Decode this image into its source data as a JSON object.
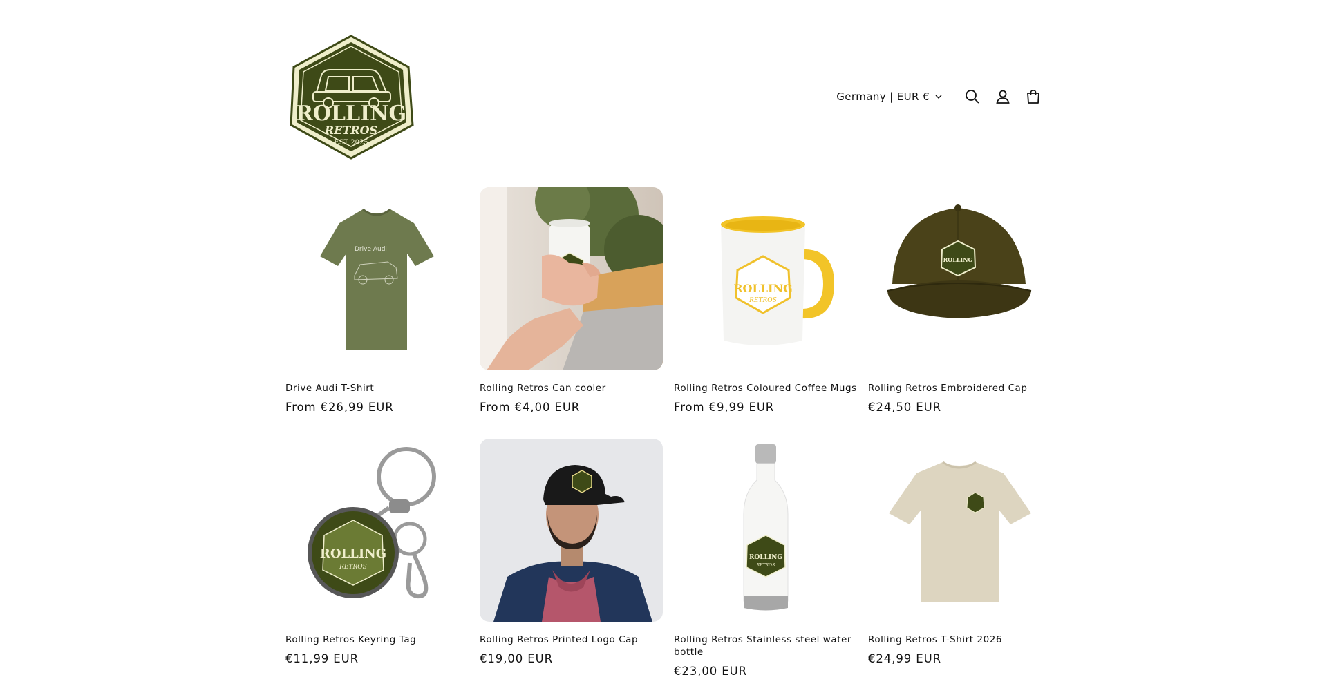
{
  "brand": {
    "name_line1": "ROLLING",
    "name_line2": "RETROS",
    "est": "EST 2025",
    "color_primary": "#3e4a17",
    "color_cream": "#efeecb"
  },
  "header": {
    "country_selector": "Germany | EUR €",
    "icons": [
      "search-icon",
      "account-icon",
      "cart-icon"
    ]
  },
  "products": [
    {
      "title": "Drive Audi T-Shirt",
      "price": "From €26,99 EUR"
    },
    {
      "title": "Rolling Retros Can cooler",
      "price": "From €4,00 EUR"
    },
    {
      "title": "Rolling Retros Coloured Coffee Mugs",
      "price": "From €9,99 EUR"
    },
    {
      "title": "Rolling Retros Embroidered Cap",
      "price": "€24,50 EUR"
    },
    {
      "title": "Rolling Retros Keyring Tag",
      "price": "€11,99 EUR"
    },
    {
      "title": "Rolling Retros Printed Logo Cap",
      "price": "€19,00 EUR"
    },
    {
      "title": "Rolling Retros Stainless steel water bottle",
      "price": "€23,00 EUR"
    },
    {
      "title": "Rolling Retros T-Shirt 2026",
      "price": "€24,99 EUR"
    }
  ],
  "mini_logo_text": "ROLLING",
  "mini_logo_sub": "RETROS",
  "shirt_print_text": "Drive Audi"
}
